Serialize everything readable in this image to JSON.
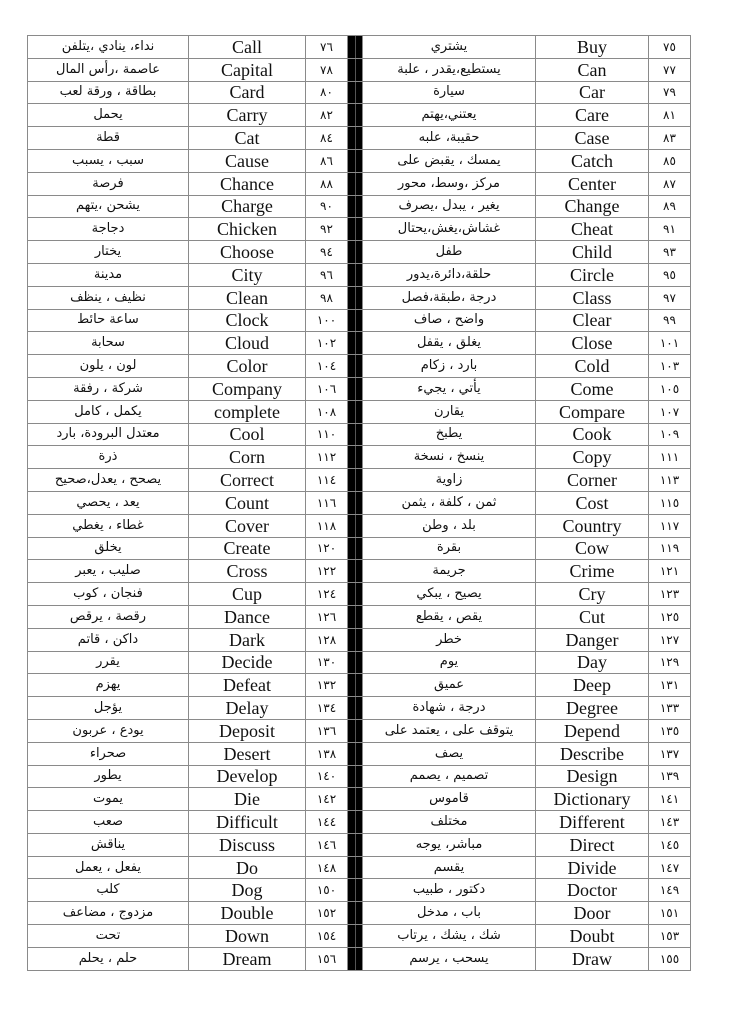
{
  "document": {
    "type": "English-Arabic vocabulary list",
    "separator_color": "#000000",
    "rows": [
      {
        "left": {
          "ar": "نداء، ينادي ،يتلفن",
          "en": "Call",
          "num": "٧٦"
        },
        "right": {
          "ar": "يشتري",
          "en": "Buy",
          "num": "٧٥"
        }
      },
      {
        "left": {
          "ar": "عاصمة ،رأس المال",
          "en": "Capital",
          "num": "٧٨"
        },
        "right": {
          "ar": "يستطيع،يقدر ، علبة",
          "en": "Can",
          "num": "٧٧"
        }
      },
      {
        "left": {
          "ar": "بطاقة ، ورقة لعب",
          "en": "Card",
          "num": "٨٠"
        },
        "right": {
          "ar": "سيارة",
          "en": "Car",
          "num": "٧٩"
        }
      },
      {
        "left": {
          "ar": "يحمل",
          "en": "Carry",
          "num": "٨٢"
        },
        "right": {
          "ar": "يعتني،يهتم",
          "en": "Care",
          "num": "٨١"
        }
      },
      {
        "left": {
          "ar": "قطة",
          "en": "Cat",
          "num": "٨٤"
        },
        "right": {
          "ar": "حقيبة، علبه",
          "en": "Case",
          "num": "٨٣"
        }
      },
      {
        "left": {
          "ar": "سبب ، يسبب",
          "en": "Cause",
          "num": "٨٦"
        },
        "right": {
          "ar": "يمسك ، يقبض على",
          "en": "Catch",
          "num": "٨٥"
        }
      },
      {
        "left": {
          "ar": "فرصة",
          "en": "Chance",
          "num": "٨٨"
        },
        "right": {
          "ar": "مركز ،وسط، محور",
          "en": "Center",
          "num": "٨٧"
        }
      },
      {
        "left": {
          "ar": "يشحن ،يتهم",
          "en": "Charge",
          "num": "٩٠"
        },
        "right": {
          "ar": "يغير ، يبدل ،يصرف",
          "en": "Change",
          "num": "٨٩"
        }
      },
      {
        "left": {
          "ar": "دجاجة",
          "en": "Chicken",
          "num": "٩٢"
        },
        "right": {
          "ar": "غشاش،يغش،يحتال",
          "en": "Cheat",
          "num": "٩١"
        }
      },
      {
        "left": {
          "ar": "يختار",
          "en": "Choose",
          "num": "٩٤"
        },
        "right": {
          "ar": "طفل",
          "en": "Child",
          "num": "٩٣"
        }
      },
      {
        "left": {
          "ar": "مدينة",
          "en": "City",
          "num": "٩٦"
        },
        "right": {
          "ar": "حلقة،دائرة،يدور",
          "en": "Circle",
          "num": "٩٥"
        }
      },
      {
        "left": {
          "ar": "نظيف ، ينظف",
          "en": "Clean",
          "num": "٩٨"
        },
        "right": {
          "ar": "درجة ،طبقة،فصل",
          "en": "Class",
          "num": "٩٧"
        }
      },
      {
        "left": {
          "ar": "ساعة حائط",
          "en": "Clock",
          "num": "١٠٠"
        },
        "right": {
          "ar": "واضح ، صاف",
          "en": "Clear",
          "num": "٩٩"
        }
      },
      {
        "left": {
          "ar": "سحابة",
          "en": "Cloud",
          "num": "١٠٢"
        },
        "right": {
          "ar": "يغلق ، يقفل",
          "en": "Close",
          "num": "١٠١"
        }
      },
      {
        "left": {
          "ar": "لون ، يلون",
          "en": "Color",
          "num": "١٠٤"
        },
        "right": {
          "ar": "بارد ، زكام",
          "en": "Cold",
          "num": "١٠٣"
        }
      },
      {
        "left": {
          "ar": "شركة ، رفقة",
          "en": "Company",
          "num": "١٠٦"
        },
        "right": {
          "ar": "يأتي ، يجيء",
          "en": "Come",
          "num": "١٠٥"
        }
      },
      {
        "left": {
          "ar": "يكمل ، كامل",
          "en": "complete",
          "num": "١٠٨"
        },
        "right": {
          "ar": "يقارن",
          "en": "Compare",
          "num": "١٠٧"
        }
      },
      {
        "left": {
          "ar": "معتدل البرودة، بارد",
          "en": "Cool",
          "num": "١١٠"
        },
        "right": {
          "ar": "يطبخ",
          "en": "Cook",
          "num": "١٠٩"
        }
      },
      {
        "left": {
          "ar": "ذرة",
          "en": "Corn",
          "num": "١١٢"
        },
        "right": {
          "ar": "ينسخ ، نسخة",
          "en": "Copy",
          "num": "١١١"
        }
      },
      {
        "left": {
          "ar": "يصحح ، يعدل،صحيح",
          "en": "Correct",
          "num": "١١٤"
        },
        "right": {
          "ar": "زاوية",
          "en": "Corner",
          "num": "١١٣"
        }
      },
      {
        "left": {
          "ar": "يعد ، يحصي",
          "en": "Count",
          "num": "١١٦"
        },
        "right": {
          "ar": "ثمن ، كلفة ، يثمن",
          "en": "Cost",
          "num": "١١٥"
        }
      },
      {
        "left": {
          "ar": "غطاء ، يغطي",
          "en": "Cover",
          "num": "١١٨"
        },
        "right": {
          "ar": "بلد ، وطن",
          "en": "Country",
          "num": "١١٧"
        }
      },
      {
        "left": {
          "ar": "يخلق",
          "en": "Create",
          "num": "١٢٠"
        },
        "right": {
          "ar": "بقرة",
          "en": "Cow",
          "num": "١١٩"
        }
      },
      {
        "left": {
          "ar": "صليب ، يعبر",
          "en": "Cross",
          "num": "١٢٢"
        },
        "right": {
          "ar": "جريمة",
          "en": "Crime",
          "num": "١٢١"
        }
      },
      {
        "left": {
          "ar": "فنجان ، كوب",
          "en": "Cup",
          "num": "١٢٤"
        },
        "right": {
          "ar": "يصيح ، يبكي",
          "en": "Cry",
          "num": "١٢٣"
        }
      },
      {
        "left": {
          "ar": "رقصة ، يرقص",
          "en": "Dance",
          "num": "١٢٦"
        },
        "right": {
          "ar": "يقص ، يقطع",
          "en": "Cut",
          "num": "١٢٥"
        }
      },
      {
        "left": {
          "ar": "داكن ، قاتم",
          "en": "Dark",
          "num": "١٢٨"
        },
        "right": {
          "ar": "خطر",
          "en": "Danger",
          "num": "١٢٧"
        }
      },
      {
        "left": {
          "ar": "يقرر",
          "en": "Decide",
          "num": "١٣٠"
        },
        "right": {
          "ar": "يوم",
          "en": "Day",
          "num": "١٢٩"
        }
      },
      {
        "left": {
          "ar": "يهزم",
          "en": "Defeat",
          "num": "١٣٢"
        },
        "right": {
          "ar": "عميق",
          "en": "Deep",
          "num": "١٣١"
        }
      },
      {
        "left": {
          "ar": "يؤجل",
          "en": "Delay",
          "num": "١٣٤"
        },
        "right": {
          "ar": "درجة ، شهادة",
          "en": "Degree",
          "num": "١٣٣"
        }
      },
      {
        "left": {
          "ar": "يودع ، عربون",
          "en": "Deposit",
          "num": "١٣٦"
        },
        "right": {
          "ar": "يتوقف على ، يعتمد على",
          "en": "Depend",
          "num": "١٣٥"
        }
      },
      {
        "left": {
          "ar": "صحراء",
          "en": "Desert",
          "num": "١٣٨"
        },
        "right": {
          "ar": "يصف",
          "en": "Describe",
          "num": "١٣٧"
        }
      },
      {
        "left": {
          "ar": "يطور",
          "en": "Develop",
          "num": "١٤٠"
        },
        "right": {
          "ar": "تصميم ، يصمم",
          "en": "Design",
          "num": "١٣٩"
        }
      },
      {
        "left": {
          "ar": "يموت",
          "en": "Die",
          "num": "١٤٢"
        },
        "right": {
          "ar": "قاموس",
          "en": "Dictionary",
          "num": "١٤١"
        }
      },
      {
        "left": {
          "ar": "صعب",
          "en": "Difficult",
          "num": "١٤٤"
        },
        "right": {
          "ar": "مختلف",
          "en": "Different",
          "num": "١٤٣"
        }
      },
      {
        "left": {
          "ar": "يناقش",
          "en": "Discuss",
          "num": "١٤٦"
        },
        "right": {
          "ar": "مباشر، يوجه",
          "en": "Direct",
          "num": "١٤٥"
        }
      },
      {
        "left": {
          "ar": "يفعل ، يعمل",
          "en": "Do",
          "num": "١٤٨"
        },
        "right": {
          "ar": "يقسم",
          "en": "Divide",
          "num": "١٤٧"
        }
      },
      {
        "left": {
          "ar": "كلب",
          "en": "Dog",
          "num": "١٥٠"
        },
        "right": {
          "ar": "دكتور ، طبيب",
          "en": "Doctor",
          "num": "١٤٩"
        }
      },
      {
        "left": {
          "ar": "مزدوج ، مضاعف",
          "en": "Double",
          "num": "١٥٢"
        },
        "right": {
          "ar": "باب ، مدخل",
          "en": "Door",
          "num": "١٥١"
        }
      },
      {
        "left": {
          "ar": "تحت",
          "en": "Down",
          "num": "١٥٤"
        },
        "right": {
          "ar": "شك ، يشك ، يرتاب",
          "en": "Doubt",
          "num": "١٥٣"
        }
      },
      {
        "left": {
          "ar": "حلم ، يحلم",
          "en": "Dream",
          "num": "١٥٦"
        },
        "right": {
          "ar": "يسحب ، يرسم",
          "en": "Draw",
          "num": "١٥٥"
        }
      }
    ]
  }
}
